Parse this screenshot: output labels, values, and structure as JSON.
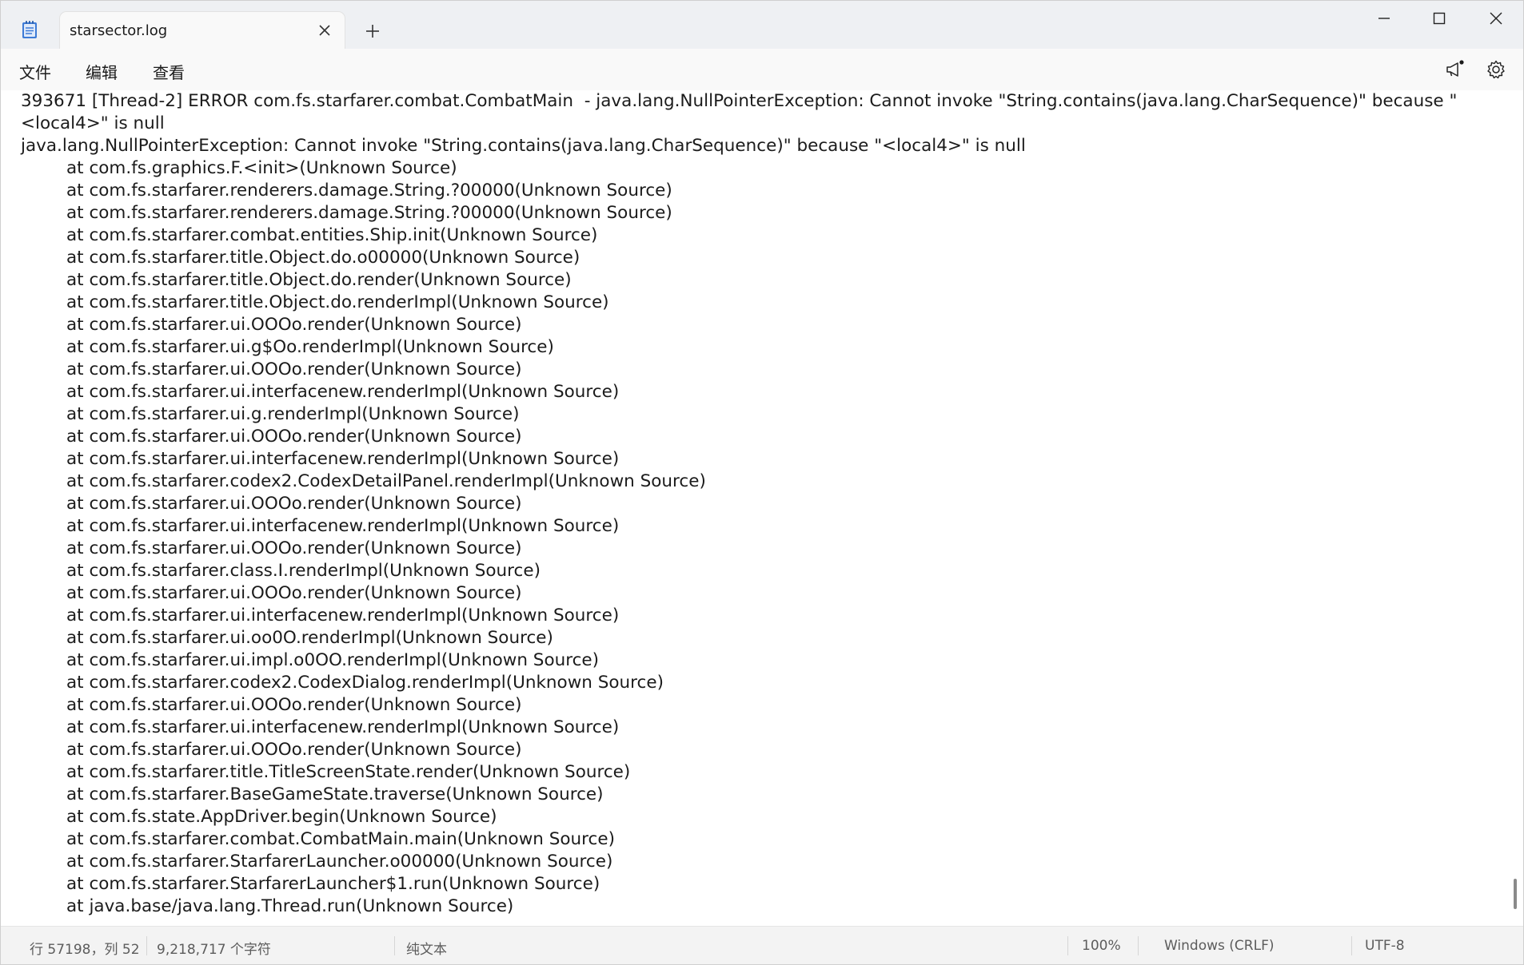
{
  "window": {
    "tab_title": "starsector.log"
  },
  "menu": {
    "file": "文件",
    "edit": "编辑",
    "view": "查看"
  },
  "icons": {
    "app": "notepad-icon",
    "close_tab": "close-icon",
    "new_tab": "plus-icon",
    "minimize": "minimize-icon",
    "maximize": "maximize-icon",
    "close_window": "close-icon",
    "announcement": "megaphone-icon",
    "settings": "gear-icon"
  },
  "colors": {
    "text": "#1b1b1b",
    "status_text": "#5c5c5c",
    "notification_dot": "#1b1b1b"
  },
  "editor": {
    "lines": [
      "393671 [Thread-2] ERROR com.fs.starfarer.combat.CombatMain  - java.lang.NullPointerException: Cannot invoke \"String.contains(java.lang.CharSequence)\" because \"<local4>\" is null",
      "java.lang.NullPointerException: Cannot invoke \"String.contains(java.lang.CharSequence)\" because \"<local4>\" is null",
      "at com.fs.graphics.F.<init>(Unknown Source)",
      "at com.fs.starfarer.renderers.damage.String.?00000(Unknown Source)",
      "at com.fs.starfarer.renderers.damage.String.?00000(Unknown Source)",
      "at com.fs.starfarer.combat.entities.Ship.init(Unknown Source)",
      "at com.fs.starfarer.title.Object.do.o00000(Unknown Source)",
      "at com.fs.starfarer.title.Object.do.render(Unknown Source)",
      "at com.fs.starfarer.title.Object.do.renderImpl(Unknown Source)",
      "at com.fs.starfarer.ui.OOOo.render(Unknown Source)",
      "at com.fs.starfarer.ui.g$Oo.renderImpl(Unknown Source)",
      "at com.fs.starfarer.ui.OOOo.render(Unknown Source)",
      "at com.fs.starfarer.ui.interfacenew.renderImpl(Unknown Source)",
      "at com.fs.starfarer.ui.g.renderImpl(Unknown Source)",
      "at com.fs.starfarer.ui.OOOo.render(Unknown Source)",
      "at com.fs.starfarer.ui.interfacenew.renderImpl(Unknown Source)",
      "at com.fs.starfarer.codex2.CodexDetailPanel.renderImpl(Unknown Source)",
      "at com.fs.starfarer.ui.OOOo.render(Unknown Source)",
      "at com.fs.starfarer.ui.interfacenew.renderImpl(Unknown Source)",
      "at com.fs.starfarer.ui.OOOo.render(Unknown Source)",
      "at com.fs.starfarer.class.I.renderImpl(Unknown Source)",
      "at com.fs.starfarer.ui.OOOo.render(Unknown Source)",
      "at com.fs.starfarer.ui.interfacenew.renderImpl(Unknown Source)",
      "at com.fs.starfarer.ui.oo0O.renderImpl(Unknown Source)",
      "at com.fs.starfarer.ui.impl.o0OO.renderImpl(Unknown Source)",
      "at com.fs.starfarer.codex2.CodexDialog.renderImpl(Unknown Source)",
      "at com.fs.starfarer.ui.OOOo.render(Unknown Source)",
      "at com.fs.starfarer.ui.interfacenew.renderImpl(Unknown Source)",
      "at com.fs.starfarer.ui.OOOo.render(Unknown Source)",
      "at com.fs.starfarer.title.TitleScreenState.render(Unknown Source)",
      "at com.fs.starfarer.BaseGameState.traverse(Unknown Source)",
      "at com.fs.state.AppDriver.begin(Unknown Source)",
      "at com.fs.starfarer.combat.CombatMain.main(Unknown Source)",
      "at com.fs.starfarer.StarfarerLauncher.o00000(Unknown Source)",
      "at com.fs.starfarer.StarfarerLauncher$1.run(Unknown Source)",
      "at java.base/java.lang.Thread.run(Unknown Source)"
    ]
  },
  "status": {
    "position": "行 57198，列 52",
    "char_count": "9,218,717 个字符",
    "format": "纯文本",
    "zoom": "100%",
    "line_ending": "Windows (CRLF)",
    "encoding": "UTF-8"
  }
}
